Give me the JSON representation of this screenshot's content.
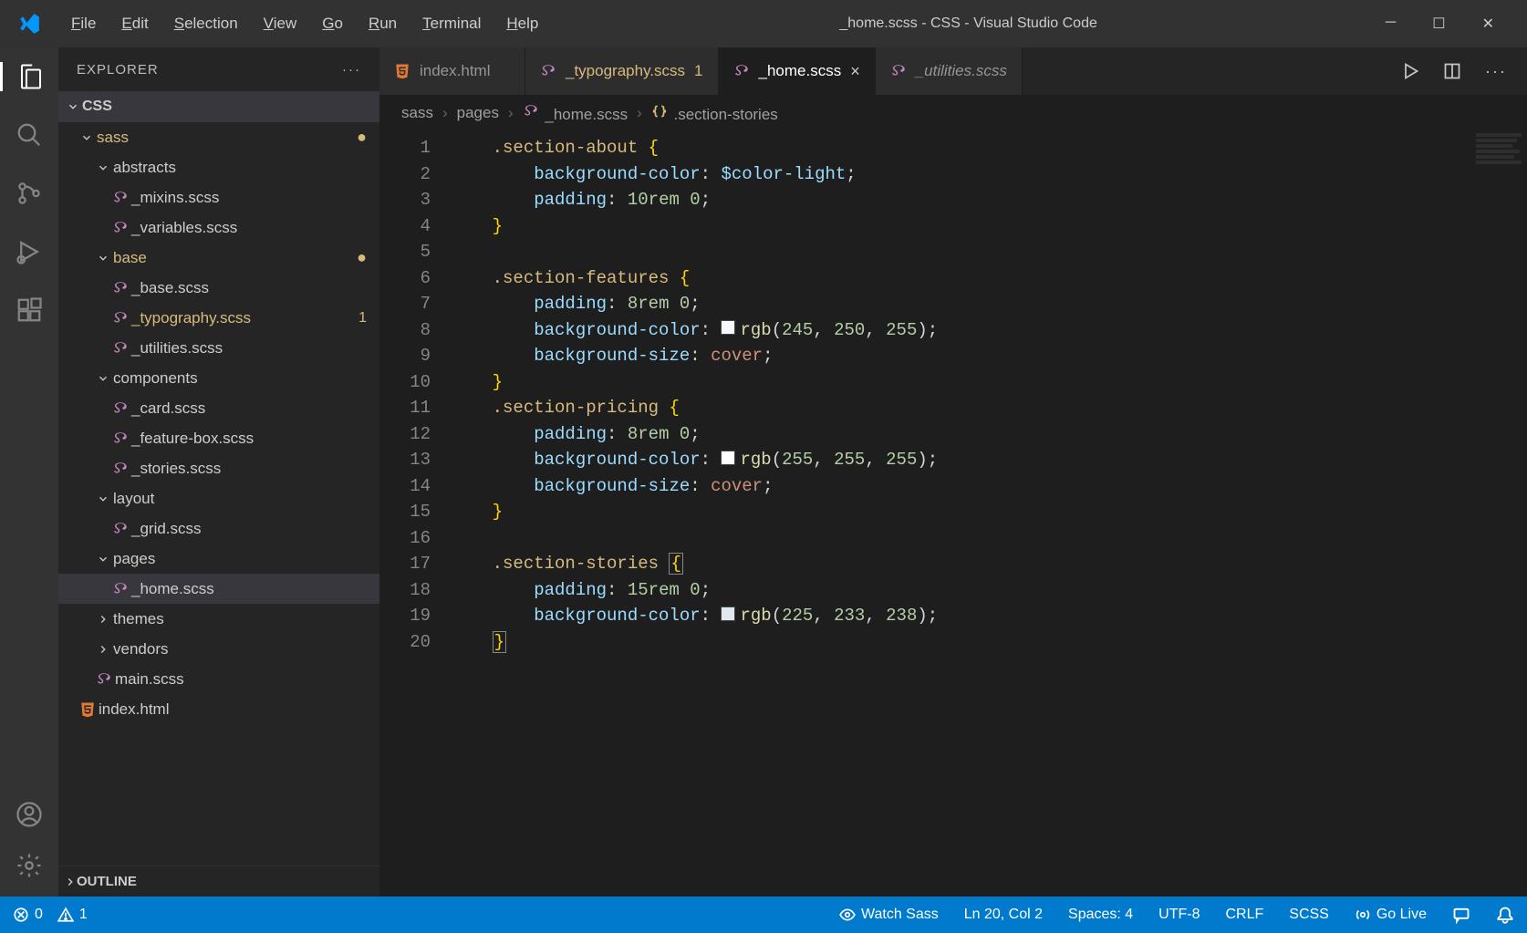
{
  "titlebar": {
    "menus": [
      "File",
      "Edit",
      "Selection",
      "View",
      "Go",
      "Run",
      "Terminal",
      "Help"
    ],
    "title": "_home.scss - CSS - Visual Studio Code"
  },
  "sidebar": {
    "header": "EXPLORER",
    "root": "CSS",
    "outline": "OUTLINE",
    "tree": [
      {
        "type": "folder",
        "depth": 0,
        "open": true,
        "label": "sass",
        "mod": true,
        "dot": true
      },
      {
        "type": "folder",
        "depth": 1,
        "open": true,
        "label": "abstracts"
      },
      {
        "type": "file",
        "depth": 2,
        "icon": "sass",
        "label": "_mixins.scss"
      },
      {
        "type": "file",
        "depth": 2,
        "icon": "sass",
        "label": "_variables.scss"
      },
      {
        "type": "folder",
        "depth": 1,
        "open": true,
        "label": "base",
        "mod": true,
        "dot": true
      },
      {
        "type": "file",
        "depth": 2,
        "icon": "sass",
        "label": "_base.scss"
      },
      {
        "type": "file",
        "depth": 2,
        "icon": "sass",
        "label": "_typography.scss",
        "mod": true,
        "count": "1"
      },
      {
        "type": "file",
        "depth": 2,
        "icon": "sass",
        "label": "_utilities.scss"
      },
      {
        "type": "folder",
        "depth": 1,
        "open": true,
        "label": "components"
      },
      {
        "type": "file",
        "depth": 2,
        "icon": "sass",
        "label": "_card.scss"
      },
      {
        "type": "file",
        "depth": 2,
        "icon": "sass",
        "label": "_feature-box.scss"
      },
      {
        "type": "file",
        "depth": 2,
        "icon": "sass",
        "label": "_stories.scss"
      },
      {
        "type": "folder",
        "depth": 1,
        "open": true,
        "label": "layout"
      },
      {
        "type": "file",
        "depth": 2,
        "icon": "sass",
        "label": "_grid.scss"
      },
      {
        "type": "folder",
        "depth": 1,
        "open": true,
        "label": "pages"
      },
      {
        "type": "file",
        "depth": 2,
        "icon": "sass",
        "label": "_home.scss",
        "selected": true
      },
      {
        "type": "folder",
        "depth": 1,
        "open": false,
        "label": "themes"
      },
      {
        "type": "folder",
        "depth": 1,
        "open": false,
        "label": "vendors"
      },
      {
        "type": "file",
        "depth": 1,
        "icon": "sass",
        "label": "main.scss"
      },
      {
        "type": "file",
        "depth": 0,
        "icon": "html",
        "label": "index.html"
      }
    ]
  },
  "tabs": [
    {
      "icon": "html",
      "label": "index.html",
      "active": false
    },
    {
      "icon": "sass",
      "label": "_typography.scss",
      "mod": true,
      "badge": "1"
    },
    {
      "icon": "sass",
      "label": "_home.scss",
      "active": true,
      "close": true
    },
    {
      "icon": "sass",
      "label": "_utilities.scss",
      "italic": true
    }
  ],
  "breadcrumb": [
    "sass",
    "pages",
    "_home.scss",
    ".section-stories"
  ],
  "code": {
    "lines": [
      {
        "n": 1,
        "html": "    <span class='tok-sel'>.section-about</span> <span class='tok-brace'>{</span>"
      },
      {
        "n": 2,
        "html": "        <span class='tok-prop'>background-color</span><span class='tok-punc'>:</span> <span class='tok-var'>$color-light</span><span class='tok-punc'>;</span>"
      },
      {
        "n": 3,
        "html": "        <span class='tok-prop'>padding</span><span class='tok-punc'>:</span> <span class='tok-num'>10rem</span> <span class='tok-num'>0</span><span class='tok-punc'>;</span>"
      },
      {
        "n": 4,
        "html": "    <span class='tok-brace'>}</span>"
      },
      {
        "n": 5,
        "html": ""
      },
      {
        "n": 6,
        "html": "    <span class='tok-sel'>.section-features</span> <span class='tok-brace'>{</span>"
      },
      {
        "n": 7,
        "html": "        <span class='tok-prop'>padding</span><span class='tok-punc'>:</span> <span class='tok-num'>8rem</span> <span class='tok-num'>0</span><span class='tok-punc'>;</span>"
      },
      {
        "n": 8,
        "html": "        <span class='tok-prop'>background-color</span><span class='tok-punc'>:</span> <span class='color-swatch' style='background:#f5faff'></span><span class='tok-func'>rgb</span><span class='tok-punc'>(</span><span class='tok-num'>245</span><span class='tok-punc'>, </span><span class='tok-num'>250</span><span class='tok-punc'>, </span><span class='tok-num'>255</span><span class='tok-punc'>);</span>"
      },
      {
        "n": 9,
        "html": "        <span class='tok-prop'>background-size</span><span class='tok-punc'>:</span> <span class='tok-val'>cover</span><span class='tok-punc'>;</span>"
      },
      {
        "n": 10,
        "html": "    <span class='tok-brace'>}</span>"
      },
      {
        "n": 11,
        "html": "    <span class='tok-sel'>.section-pricing</span> <span class='tok-brace'>{</span>"
      },
      {
        "n": 12,
        "html": "        <span class='tok-prop'>padding</span><span class='tok-punc'>:</span> <span class='tok-num'>8rem</span> <span class='tok-num'>0</span><span class='tok-punc'>;</span>"
      },
      {
        "n": 13,
        "html": "        <span class='tok-prop'>background-color</span><span class='tok-punc'>:</span> <span class='color-swatch' style='background:#ffffff'></span><span class='tok-func'>rgb</span><span class='tok-punc'>(</span><span class='tok-num'>255</span><span class='tok-punc'>, </span><span class='tok-num'>255</span><span class='tok-punc'>, </span><span class='tok-num'>255</span><span class='tok-punc'>);</span>"
      },
      {
        "n": 14,
        "html": "        <span class='tok-prop'>background-size</span><span class='tok-punc'>:</span> <span class='tok-val'>cover</span><span class='tok-punc'>;</span>"
      },
      {
        "n": 15,
        "html": "    <span class='tok-brace'>}</span>"
      },
      {
        "n": 16,
        "html": ""
      },
      {
        "n": 17,
        "html": "    <span class='tok-sel'>.section-stories</span> <span class='tok-brace brace-match'>{</span>"
      },
      {
        "n": 18,
        "html": "        <span class='tok-prop'>padding</span><span class='tok-punc'>:</span> <span class='tok-num'>15rem</span> <span class='tok-num'>0</span><span class='tok-punc'>;</span>"
      },
      {
        "n": 19,
        "html": "        <span class='tok-prop'>background-color</span><span class='tok-punc'>:</span> <span class='color-swatch' style='background:#e1e9ee'></span><span class='tok-func'>rgb</span><span class='tok-punc'>(</span><span class='tok-num'>225</span><span class='tok-punc'>, </span><span class='tok-num'>233</span><span class='tok-punc'>, </span><span class='tok-num'>238</span><span class='tok-punc'>);</span>"
      },
      {
        "n": 20,
        "html": "    <span class='tok-brace brace-match'>}</span>"
      }
    ]
  },
  "statusbar": {
    "errors": "0",
    "warnings": "1",
    "watch": "Watch Sass",
    "pos": "Ln 20, Col 2",
    "spaces": "Spaces: 4",
    "encoding": "UTF-8",
    "eol": "CRLF",
    "lang": "SCSS",
    "golive": "Go Live"
  }
}
